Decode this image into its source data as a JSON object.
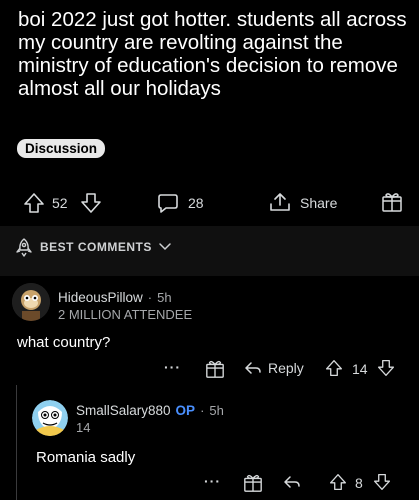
{
  "post": {
    "title": "boi 2022 just got hotter. students all across my country are revolting against the ministry of education's decision to remove almost all our holidays",
    "flair": "Discussion",
    "upvotes": "52",
    "comments": "28",
    "share_label": "Share"
  },
  "sort": {
    "label": "BEST COMMENTS"
  },
  "comments": [
    {
      "username": "HideousPillow",
      "separator": "·",
      "time": "5h",
      "flair": "2 MILLION ATTENDEE",
      "body": "what country?",
      "more": "···",
      "reply_label": "Reply",
      "score": "14"
    },
    {
      "username": "SmallSalary880",
      "op_badge": "OP",
      "separator": "·",
      "time": "5h",
      "flair": "14",
      "body": "Romania sadly",
      "more": "···",
      "score": "8"
    }
  ],
  "colors": {
    "background": "#000000",
    "op_blue": "#4a90ff",
    "band": "#101010"
  }
}
